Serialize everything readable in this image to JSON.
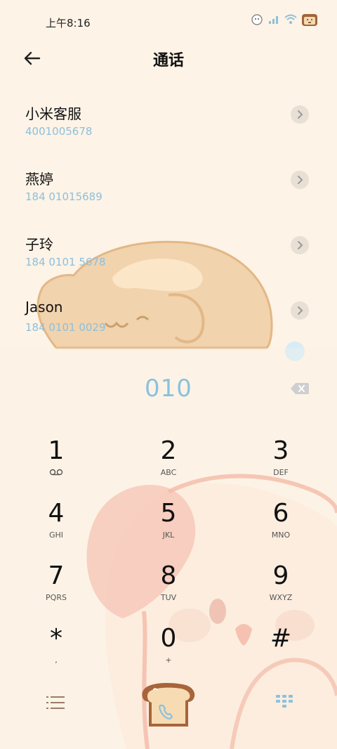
{
  "status": {
    "time": "上午8:16"
  },
  "header": {
    "title": "通话"
  },
  "contacts": [
    {
      "name": "小米客服",
      "number": "4001005678"
    },
    {
      "name": "燕婷",
      "number": "184 01015689"
    },
    {
      "name": "子玲",
      "number": "184 0101 5678"
    },
    {
      "name": "Jason",
      "number": "184 0101 0029"
    }
  ],
  "dialer": {
    "input": "010",
    "keys": [
      {
        "digit": "1",
        "letters": ""
      },
      {
        "digit": "2",
        "letters": "ABC"
      },
      {
        "digit": "3",
        "letters": "DEF"
      },
      {
        "digit": "4",
        "letters": "GHI"
      },
      {
        "digit": "5",
        "letters": "JKL"
      },
      {
        "digit": "6",
        "letters": "MNO"
      },
      {
        "digit": "7",
        "letters": "PQRS"
      },
      {
        "digit": "8",
        "letters": "TUV"
      },
      {
        "digit": "9",
        "letters": "WXYZ"
      },
      {
        "digit": "*",
        "letters": ","
      },
      {
        "digit": "0",
        "letters": "+"
      },
      {
        "digit": "#",
        "letters": ""
      }
    ]
  },
  "colors": {
    "background": "#fdf3e6",
    "accent": "#8cc0de",
    "bread": "#e9c08e",
    "bunny": "#f2b7a6"
  },
  "icons": [
    "back-arrow-icon",
    "chevron-right-icon",
    "voicemail-icon",
    "backspace-icon",
    "menu-list-icon",
    "toast-phone-icon",
    "dialpad-icon"
  ]
}
